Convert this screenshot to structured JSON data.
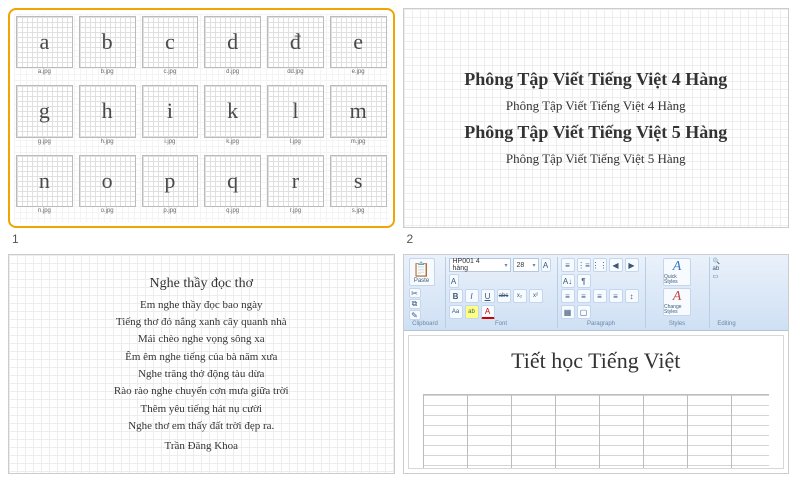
{
  "page_numbers": [
    "1",
    "2"
  ],
  "panel1": {
    "selected": true,
    "letters": [
      {
        "glyph": "a",
        "file": "a.jpg"
      },
      {
        "glyph": "b",
        "file": "b.jpg"
      },
      {
        "glyph": "c",
        "file": "c.jpg"
      },
      {
        "glyph": "d",
        "file": "d.jpg"
      },
      {
        "glyph": "đ",
        "file": "dd.jpg"
      },
      {
        "glyph": "e",
        "file": "e.jpg"
      },
      {
        "glyph": "g",
        "file": "g.jpg"
      },
      {
        "glyph": "h",
        "file": "h.jpg"
      },
      {
        "glyph": "i",
        "file": "i.jpg"
      },
      {
        "glyph": "k",
        "file": "k.jpg"
      },
      {
        "glyph": "l",
        "file": "l.jpg"
      },
      {
        "glyph": "m",
        "file": "m.jpg"
      },
      {
        "glyph": "n",
        "file": "n.jpg"
      },
      {
        "glyph": "o",
        "file": "o.jpg"
      },
      {
        "glyph": "p",
        "file": "p.jpg"
      },
      {
        "glyph": "q",
        "file": "q.jpg"
      },
      {
        "glyph": "r",
        "file": "r.jpg"
      },
      {
        "glyph": "s",
        "file": "s.jpg"
      }
    ]
  },
  "panel2": {
    "line1": "Phông Tập Viết Tiếng Việt 4 Hàng",
    "line2": "Phông Tập Viết Tiếng Việt 4 Hàng",
    "line3": "Phông Tập Viết Tiếng Việt 5 Hàng",
    "line4": "Phông Tập Viết Tiếng Việt 5 Hàng"
  },
  "panel3": {
    "title": "Nghe thầy đọc thơ",
    "lines": [
      "Em nghe thầy đọc bao ngày",
      "Tiếng thơ đỏ nắng xanh cây quanh nhà",
      "Mái chèo nghe vọng sông xa",
      "Êm êm nghe tiếng của bà năm xưa",
      "Nghe trăng thở động tàu dừa",
      "Rào rào nghe chuyển cơn mưa giữa trời",
      "Thêm yêu tiếng hát nụ cười",
      "Nghe thơ em thấy đất trời đẹp ra."
    ],
    "signature": "Trần Đăng Khoa"
  },
  "panel4": {
    "ribbon": {
      "clipboard": {
        "label": "Clipboard",
        "paste": "Paste"
      },
      "font": {
        "label": "Font",
        "name": "HP001 4 hàng",
        "size": "28",
        "bold": "B",
        "italic": "I",
        "underline": "U",
        "strike": "abc",
        "sub": "x₂",
        "sup": "x²",
        "clear": "Aa",
        "highlight": "ab",
        "color": "A"
      },
      "paragraph": {
        "label": "Paragraph"
      },
      "styles": {
        "label": "Styles",
        "quick": "Quick Styles",
        "change": "Change Styles"
      },
      "editing": {
        "label": "Editing"
      }
    },
    "doc_title": "Tiết học Tiếng Việt"
  }
}
